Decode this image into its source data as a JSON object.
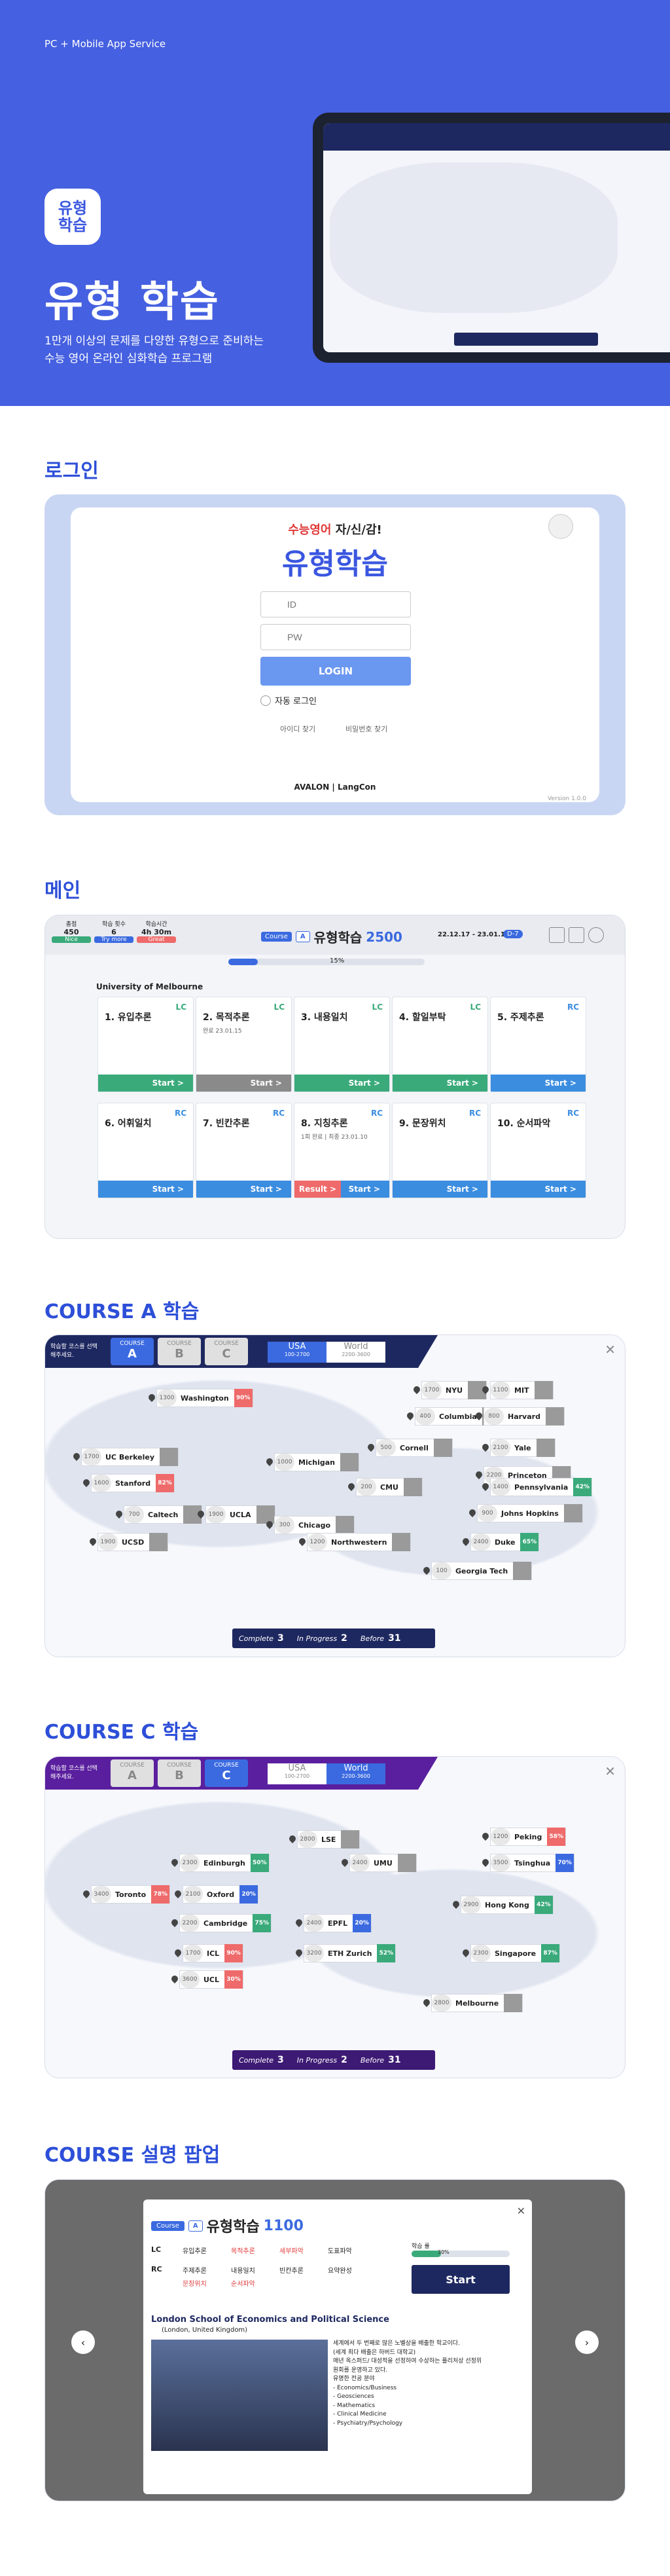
{
  "hero": {
    "tag": "PC + Mobile App Service",
    "icon_line1": "유형",
    "icon_line2": "학습",
    "title": "유형 학습",
    "desc_line1": "1만개 이상의 문제를 다양한 유형으로 준비하는",
    "desc_line2": "수능 영어 온라인 심화학습 프로그램"
  },
  "sections": {
    "login": "로그인",
    "main": "메인",
    "course_a": "COURSE A 학습",
    "course_c": "COURSE C 학습",
    "popup": "COURSE 설명 팝업"
  },
  "login": {
    "tagline_red": "수능영어",
    "tagline_rest": "자/신/감!",
    "logo": "유형학습",
    "id_placeholder": "ID",
    "pw_placeholder": "PW",
    "login_btn": "LOGIN",
    "auto_login": "자동 로그인",
    "find_id": "아이디 찾기",
    "find_pw": "비밀번호 찾기",
    "brand": "AVALON | LangCon",
    "version": "Version 1.0.0"
  },
  "main": {
    "stats": [
      {
        "label": "총점",
        "value": "450",
        "badge": "Nice"
      },
      {
        "label": "학습 횟수",
        "value": "6",
        "badge": "Try more"
      },
      {
        "label": "학습시간",
        "value": "4h 30m",
        "badge": "Great"
      }
    ],
    "course_label": "Course",
    "course_letter": "A",
    "title": "유형학습",
    "score": "2500",
    "date_range": "22.12.17 - 23.01.17",
    "dday": "D-7",
    "progress": "15%",
    "university": "University of Melbourne",
    "cards": [
      {
        "title": "1. 유입추론",
        "tag": "LC",
        "foot": "Start >",
        "color": "green"
      },
      {
        "title": "2. 목적추론",
        "tag": "LC",
        "sub": "완료 23.01.15",
        "foot": "Start >",
        "color": "gray"
      },
      {
        "title": "3. 내용일치",
        "tag": "LC",
        "foot": "Start >",
        "color": "green"
      },
      {
        "title": "4. 할일부탁",
        "tag": "LC",
        "foot": "Start >",
        "color": "green"
      },
      {
        "title": "5. 주제추론",
        "tag": "RC",
        "foot": "Start >",
        "color": "blue"
      },
      {
        "title": "6. 어휘일치",
        "tag": "RC",
        "foot": "Start >",
        "color": "blue"
      },
      {
        "title": "7. 빈칸추론",
        "tag": "RC",
        "foot": "Start >",
        "color": "blue"
      },
      {
        "title": "8. 지칭추론",
        "tag": "RC",
        "sub": "1회 완료 | 최종 23.01.10",
        "foot": "Start >",
        "result": "Result >",
        "color": "red"
      },
      {
        "title": "9. 문장위치",
        "tag": "RC",
        "foot": "Start >",
        "color": "blue"
      },
      {
        "title": "10. 순서파악",
        "tag": "RC",
        "foot": "Start >",
        "color": "blue"
      }
    ]
  },
  "course_a": {
    "instruction": "학습할 코스를 선택해주세요.",
    "tabs": [
      "A",
      "B",
      "C"
    ],
    "tab_label": "COURSE",
    "region_tabs": [
      {
        "name": "USA",
        "range": "100-2700"
      },
      {
        "name": "World",
        "range": "2200-3600"
      }
    ],
    "schools": [
      {
        "num": "1300",
        "name": "Washington",
        "pct": "90%",
        "c": "red"
      },
      {
        "num": "1700",
        "name": "NYU",
        "pct": "",
        "c": "gray"
      },
      {
        "num": "1100",
        "name": "MIT",
        "pct": "",
        "c": "gray"
      },
      {
        "num": "400",
        "name": "Columbia",
        "pct": "",
        "c": "gray"
      },
      {
        "num": "800",
        "name": "Harvard",
        "pct": "",
        "c": "gray"
      },
      {
        "num": "1700",
        "name": "UC Berkeley",
        "pct": "",
        "c": "gray"
      },
      {
        "num": "500",
        "name": "Cornell",
        "pct": "",
        "c": "gray"
      },
      {
        "num": "2100",
        "name": "Yale",
        "pct": "",
        "c": "gray"
      },
      {
        "num": "1000",
        "name": "Michigan",
        "pct": "",
        "c": "gray"
      },
      {
        "num": "2200",
        "name": "Princeton",
        "pct": "",
        "c": "gray"
      },
      {
        "num": "1600",
        "name": "Stanford",
        "pct": "82%",
        "c": "red"
      },
      {
        "num": "200",
        "name": "CMU",
        "pct": "",
        "c": "gray"
      },
      {
        "num": "1400",
        "name": "Pennsylvania",
        "pct": "42%",
        "c": "green"
      },
      {
        "num": "700",
        "name": "Caltech",
        "pct": "",
        "c": "gray"
      },
      {
        "num": "1900",
        "name": "UCLA",
        "pct": "",
        "c": "gray"
      },
      {
        "num": "900",
        "name": "Johns Hopkins",
        "pct": "",
        "c": "gray"
      },
      {
        "num": "300",
        "name": "Chicago",
        "pct": "",
        "c": "gray"
      },
      {
        "num": "1900",
        "name": "UCSD",
        "pct": "",
        "c": "gray"
      },
      {
        "num": "1200",
        "name": "Northwestern",
        "pct": "",
        "c": "gray"
      },
      {
        "num": "2400",
        "name": "Duke",
        "pct": "65%",
        "c": "green"
      },
      {
        "num": "100",
        "name": "Georgia Tech",
        "pct": "",
        "c": "gray"
      }
    ],
    "status": {
      "complete_label": "Complete",
      "complete": "3",
      "progress_label": "In Progress",
      "progress": "2",
      "before_label": "Before",
      "before": "31"
    }
  },
  "course_c": {
    "schools": [
      {
        "num": "2800",
        "name": "LSE",
        "pct": "",
        "c": "gray"
      },
      {
        "num": "1200",
        "name": "Peking",
        "pct": "58%",
        "c": "red"
      },
      {
        "num": "2300",
        "name": "Edinburgh",
        "pct": "50%",
        "c": "green"
      },
      {
        "num": "2400",
        "name": "UMU",
        "pct": "",
        "c": "gray"
      },
      {
        "num": "3500",
        "name": "Tsinghua",
        "pct": "70%",
        "c": "blue"
      },
      {
        "num": "3400",
        "name": "Toronto",
        "pct": "78%",
        "c": "red"
      },
      {
        "num": "2100",
        "name": "Oxford",
        "pct": "20%",
        "c": "blue"
      },
      {
        "num": "2900",
        "name": "Hong Kong",
        "pct": "42%",
        "c": "green"
      },
      {
        "num": "2200",
        "name": "Cambridge",
        "pct": "75%",
        "c": "green"
      },
      {
        "num": "2400",
        "name": "EPFL",
        "pct": "20%",
        "c": "blue"
      },
      {
        "num": "1700",
        "name": "ICL",
        "pct": "90%",
        "c": "red"
      },
      {
        "num": "3200",
        "name": "ETH Zurich",
        "pct": "52%",
        "c": "green"
      },
      {
        "num": "2300",
        "name": "Singapore",
        "pct": "87%",
        "c": "green"
      },
      {
        "num": "3600",
        "name": "UCL",
        "pct": "30%",
        "c": "red"
      },
      {
        "num": "2800",
        "name": "Melbourne",
        "pct": "",
        "c": "gray"
      }
    ],
    "status": {
      "complete": "3",
      "progress": "2",
      "before": "31"
    }
  },
  "popup": {
    "course_label": "Course",
    "course_letter": "A",
    "title": "유형학습",
    "score": "1100",
    "lc_label": "LC",
    "rc_label": "RC",
    "lc_items": [
      "유입추론",
      "목적추론",
      "세부파악",
      "도표파악"
    ],
    "rc_items": [
      "주제추론",
      "내용일치",
      "빈칸추론",
      "요약완성",
      "문장위치",
      "순서파악"
    ],
    "progress_label": "학습 률",
    "progress_value": "30%",
    "progress_fraction": 0.3,
    "start_btn": "Start",
    "school_name": "London School of Economics and Political Science",
    "school_loc": "(London, United Kingdom)",
    "desc_lines": [
      "세계에서 두 번째로 많은 노벨상을 배출한 학교이다.",
      "(세계 최다 배출은 하버드 대학교)",
      "매년 옥스퍼드/ 대성적을 선정하여 수상하는 플리처상 선정위",
      "원회를 운영하고 있다.",
      "유명한 전공 분야",
      "- Economics/Business",
      "- Geosciences",
      "- Mathematics",
      "- Clinical Medicine",
      "- Psychiatry/Psychology"
    ]
  }
}
